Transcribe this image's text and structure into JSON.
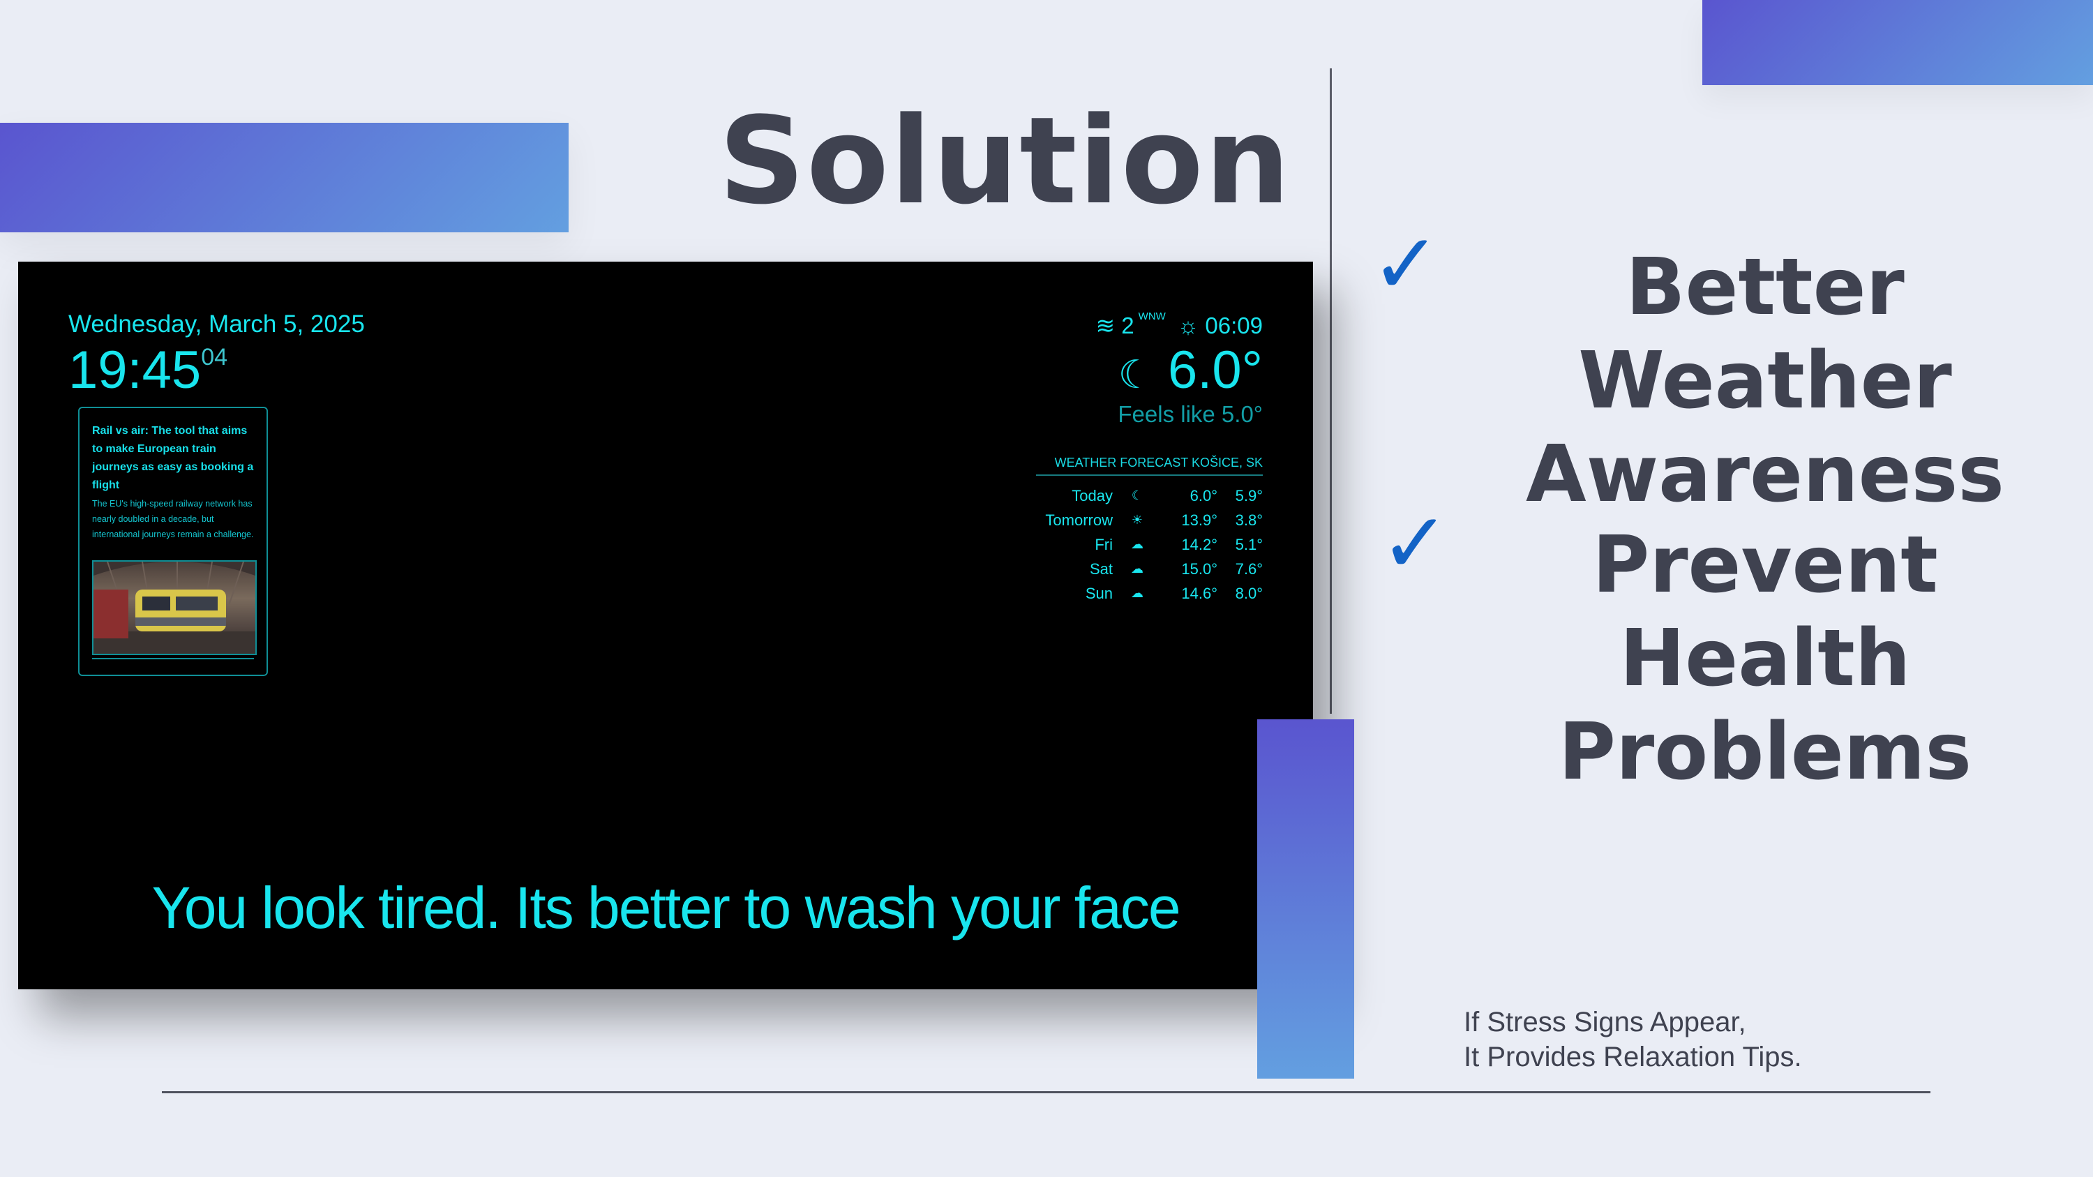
{
  "slide": {
    "title": "Solution",
    "features": [
      {
        "line1": "Better Weather",
        "line2": "Awareness",
        "check_icon": "checkmark-icon"
      },
      {
        "line1": "Prevent Health",
        "line2": "Problems",
        "check_icon": "checkmark-icon"
      }
    ],
    "footnote": {
      "line1": "If Stress Signs Appear,",
      "line2": "It Provides Relaxation Tips."
    },
    "colors": {
      "accent_start": "#5a55cf",
      "accent_end": "#639fe0",
      "check": "#1363c6",
      "text": "#3f4250",
      "background": "#eaedf5"
    }
  },
  "mirror": {
    "date": "Wednesday, March 5, 2025",
    "time": "19:45",
    "seconds": "04",
    "news": {
      "title": "Rail vs air: The tool that aims to make European train journeys as easy as booking a flight",
      "description": "The EU's high-speed railway network has nearly doubled in a decade, but international journeys remain a challenge.",
      "image_icon": "train-station-image"
    },
    "weather": {
      "wind_speed": "2",
      "wind_dir": "WNW",
      "sunrise": "06:09",
      "temperature": "6.0°",
      "feels_like": "Feels like 5.0°",
      "forecast_header": "WEATHER FORECAST KOŠICE, SK",
      "forecast": [
        {
          "day": "Today",
          "icon": "moon-icon",
          "hi": "6.0°",
          "lo": "5.9°"
        },
        {
          "day": "Tomorrow",
          "icon": "sun-icon",
          "hi": "13.9°",
          "lo": "3.8°"
        },
        {
          "day": "Fri",
          "icon": "cloud-icon",
          "hi": "14.2°",
          "lo": "5.1°"
        },
        {
          "day": "Sat",
          "icon": "cloud-icon",
          "hi": "15.0°",
          "lo": "7.6°"
        },
        {
          "day": "Sun",
          "icon": "cloud-icon",
          "hi": "14.6°",
          "lo": "8.0°"
        }
      ]
    },
    "message": "You look tired. Its better to wash your face",
    "text_color": "#19e5ee"
  }
}
